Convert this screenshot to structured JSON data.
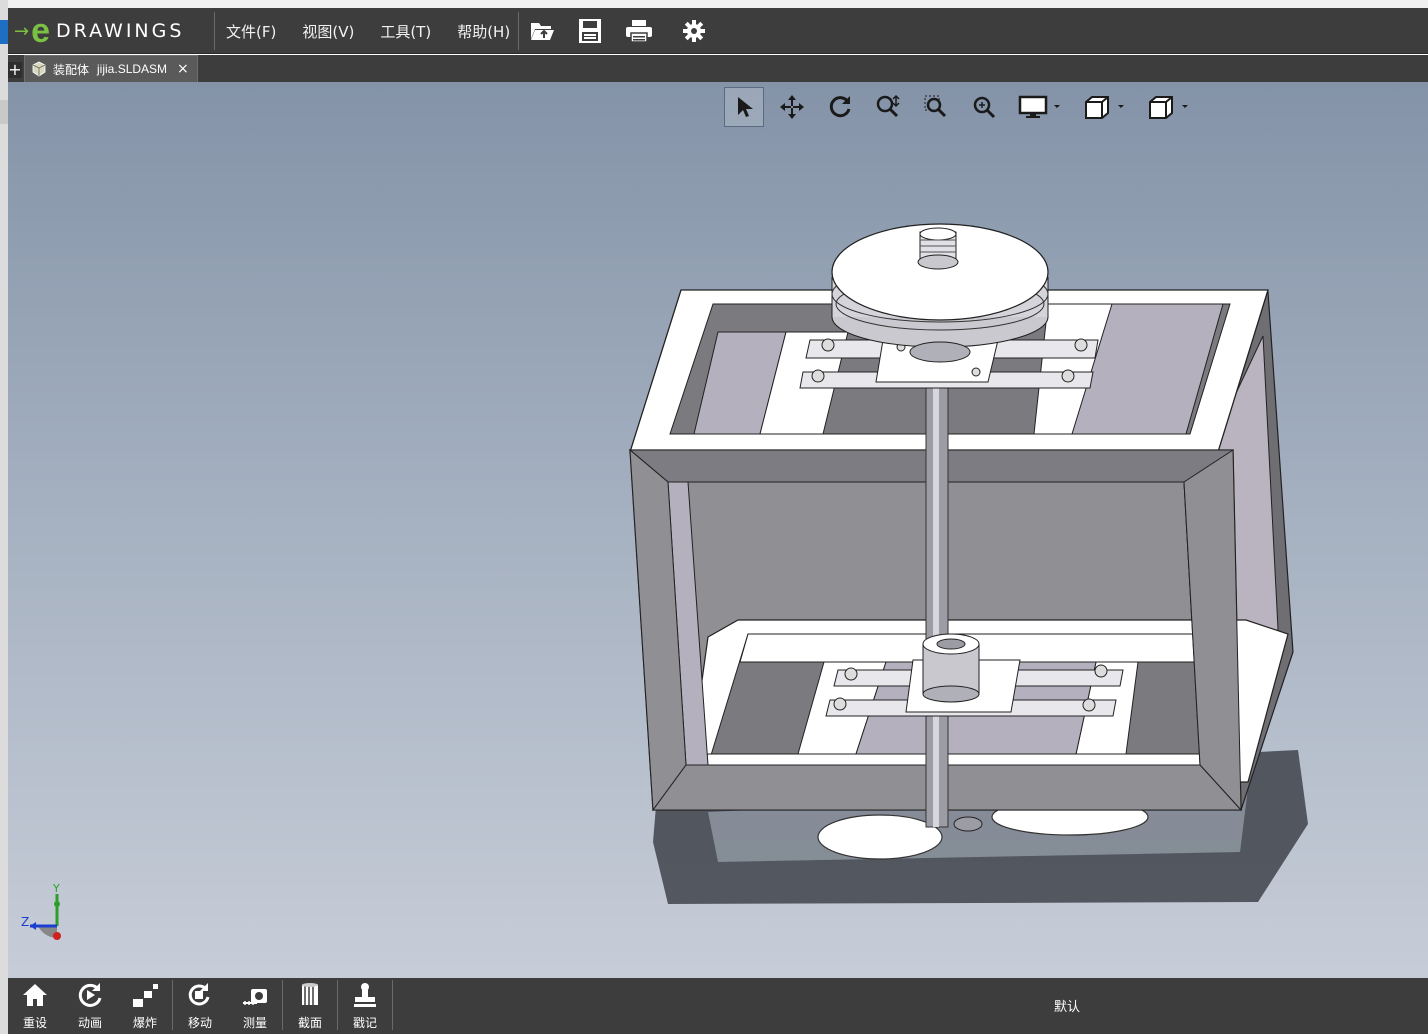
{
  "app": {
    "logo_arrow": "→",
    "logo_e": "e",
    "logo_word": "DRAWINGS"
  },
  "menu": {
    "file": "文件(F)",
    "view": "视图(V)",
    "tools": "工具(T)",
    "help": "帮助(H)"
  },
  "toolbar_icons": [
    "open-icon",
    "save-icon",
    "print-icon",
    "settings-icon"
  ],
  "tab": {
    "plus": "+",
    "type_label": "装配体",
    "file_name": "jijia.SLDASM",
    "close": "×"
  },
  "heads_up_icons": [
    "select-icon",
    "pan-icon",
    "rotate-icon",
    "zoom-icon",
    "zoom-to-area-icon",
    "zoom-to-fit-icon",
    "display-style-icon",
    "view-orientation-icon",
    "standard-views-icon"
  ],
  "triad": {
    "y": "Y",
    "z": "Z"
  },
  "bottom_tools": [
    {
      "label": "重设",
      "icon": "home-icon"
    },
    {
      "label": "动画",
      "icon": "animate-icon"
    },
    {
      "label": "爆炸",
      "icon": "explode-icon"
    },
    {
      "label": "移动",
      "icon": "move-icon"
    },
    {
      "label": "测量",
      "icon": "measure-icon"
    },
    {
      "label": "截面",
      "icon": "section-icon"
    },
    {
      "label": "戳记",
      "icon": "stamp-icon"
    }
  ],
  "status": {
    "configuration": "默认"
  },
  "colors": {
    "chrome": "#3d3d3d",
    "accent_green": "#7ac143",
    "viewport_top": "#8493a8",
    "viewport_bottom": "#c7cdd8"
  }
}
